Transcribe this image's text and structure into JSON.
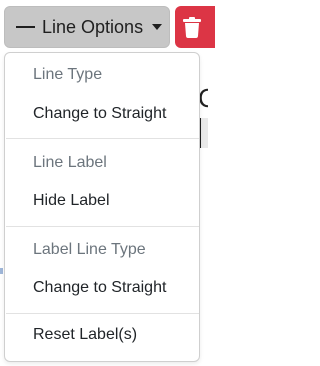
{
  "toolbar": {
    "line_options_label": "Line Options",
    "line_icon": "horizontal-line-icon",
    "caret_icon": "caret-down-icon",
    "delete_icon": "trash-icon",
    "delete_color": "#dc3545"
  },
  "background": {
    "partial_glyph": "C"
  },
  "menu": {
    "sections": [
      {
        "header": "Line Type",
        "item": "Change to Straight"
      },
      {
        "header": "Line Label",
        "item": "Hide Label"
      },
      {
        "header": "Label Line Type",
        "item": "Change to Straight"
      }
    ],
    "reset_label": "Reset Label(s)"
  }
}
